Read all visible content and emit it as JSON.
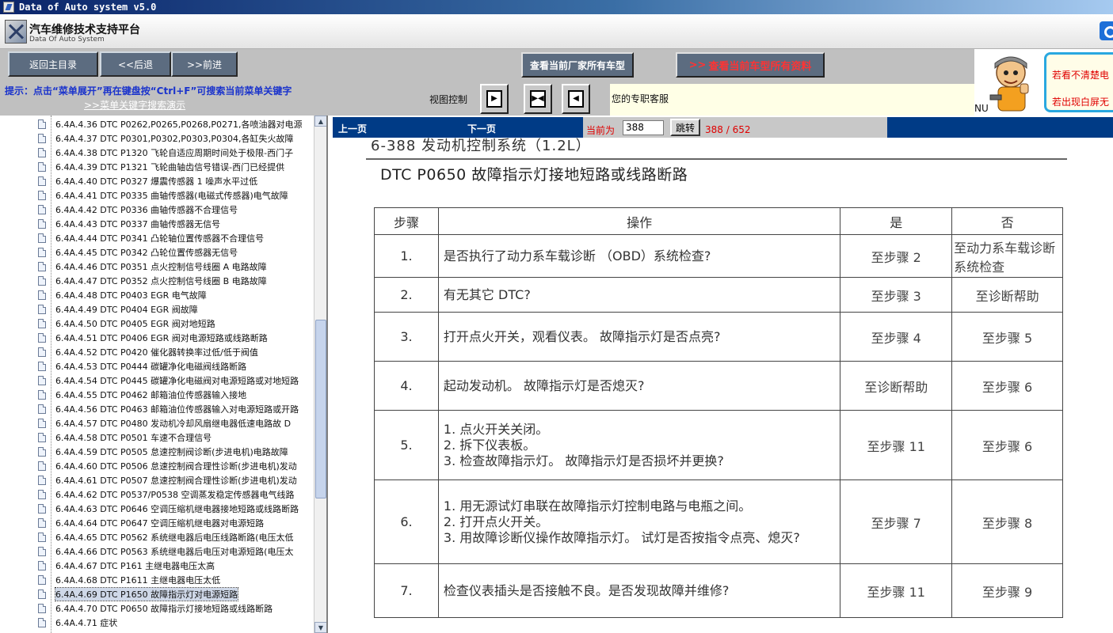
{
  "window": {
    "title": "Data of Auto system v5.0"
  },
  "logo": {
    "title": "汽车维修技术支持平台",
    "subtitle": "Data Of Auto System"
  },
  "toolbar": {
    "home_label": "返回主目录",
    "back_label": "<<后退",
    "forward_label": ">>前进",
    "maker_cars_label": "查看当前厂家所有车型",
    "all_info_label": "查看当前车型所有资料",
    "hint": "提示：点击“菜单展开”再在键盘按“Ctrl+F”可搜索当前菜单关键字",
    "hint_link": ">>菜单关键字搜索演示",
    "view_control_label": "视图控制",
    "service_text": "您的专职客服"
  },
  "ad": {
    "line1": "若看不清楚电",
    "line2": "若出现白屏无",
    "prefix": "NU"
  },
  "tree": {
    "items": [
      "6.4A.4.36 DTC P0262,P0265,P0268,P0271,各喷油器对电源",
      "6.4A.4.37 DTC P0301,P0302,P0303,P0304,各缸失火故障",
      "6.4A.4.38 DTC P1320 飞轮自适应周期时间处于极限-西门子",
      "6.4A.4.39 DTC P1321 飞轮曲轴齿信号错误-西门已经提供",
      "6.4A.4.40 DTC P0327 爆震传感器 1 噪声水平过低",
      "6.4A.4.41 DTC P0335 曲轴传感器(电磁式传感器)电气故障",
      "6.4A.4.42 DTC P0336 曲轴传感器不合理信号",
      "6.4A.4.43 DTC P0337 曲轴传感器无信号",
      "6.4A.4.44 DTC P0341 凸轮轴位置传感器不合理信号",
      "6.4A.4.45 DTC P0342 凸轮位置传感器无信号",
      "6.4A.4.46 DTC P0351 点火控制信号线圈 A 电路故障",
      "6.4A.4.47 DTC P0352 点火控制信号线圈 B 电路故障",
      "6.4A.4.48 DTC P0403 EGR 电气故障",
      "6.4A.4.49 DTC P0404 EGR 阀故障",
      "6.4A.4.50 DTC P0405 EGR 阀对地短路",
      "6.4A.4.51 DTC P0406 EGR 阀对电源短路或线路断路",
      "6.4A.4.52 DTC P0420 催化器转换率过低/低于阀值",
      "6.4A.4.53 DTC P0444 碳罐净化电磁阀线路断路",
      "6.4A.4.54 DTC P0445 碳罐净化电磁阀对电源短路或对地短路",
      "6.4A.4.55 DTC P0462 邮箱油位传感器输入接地",
      "6.4A.4.56 DTC P0463 邮箱油位传感器输入对电源短路或开路",
      "6.4A.4.57 DTC P0480 发动机冷却风扇继电器低速电路故 D",
      "6.4A.4.58 DTC P0501 车速不合理信号",
      "6.4A.4.59 DTC P0505 怠速控制阀诊断(步进电机)电路故障",
      "6.4A.4.60 DTC P0506 怠速控制阀合理性诊断(步进电机)发动",
      "6.4A.4.61 DTC P0507 怠速控制阀合理性诊断(步进电机)发动",
      "6.4A.4.62 DTC P0537/P0538 空调蒸发稳定传感器电气线路",
      "6.4A.4.63 DTC P0646 空调压缩机继电器接地短路或线路断路",
      "6.4A.4.64 DTC P0647 空调压缩机继电器对电源短路",
      "6.4A.4.65 DTC P0562 系统继电器后电压线路断路(电压太低",
      "6.4A.4.66 DTC P0563 系统继电器后电压对电源短路(电压太",
      "6.4A.4.67 DTC P161 主继电器电压太高",
      "6.4A.4.68 DTC P1611 主继电器电压太低",
      "6.4A.4.69 DTC P1650 故障指示灯对电源短路",
      "6.4A.4.70 DTC P0650 故障指示灯接地短路或线路断路",
      "6.4A.4.71 症状"
    ],
    "selected_index": 33
  },
  "docnav": {
    "prev_label": "上一页",
    "next_label": "下一页",
    "current_label": "当前为",
    "page_value": "388",
    "jump_label": "跳转",
    "page_count": "388 / 652"
  },
  "document": {
    "header": "6-388 发动机控制系统（1.2L）",
    "title": "DTC P0650  故障指示灯接地短路或线路断路",
    "columns": [
      "步骤",
      "操作",
      "是",
      "否"
    ],
    "rows": [
      {
        "step": "1.",
        "op": [
          "是否执行了动力系车载诊断 （OBD）系统检查?"
        ],
        "yes": "至步骤 2",
        "no": "至动力系车载诊断系统检查"
      },
      {
        "step": "2.",
        "op": [
          "有无其它 DTC?"
        ],
        "yes": "至步骤 3",
        "no": "至诊断帮助"
      },
      {
        "step": "3.",
        "op": [
          "打开点火开关，观看仪表。 故障指示灯是否点亮?"
        ],
        "yes": "至步骤 4",
        "no": "至步骤 5"
      },
      {
        "step": "4.",
        "op": [
          "起动发动机。 故障指示灯是否熄灭?"
        ],
        "yes": "至诊断帮助",
        "no": "至步骤 6"
      },
      {
        "step": "5.",
        "op": [
          "1. 点火开关关闭。",
          "2. 拆下仪表板。",
          "3. 检查故障指示灯。 故障指示灯是否损坏并更换?"
        ],
        "yes": "至步骤 11",
        "no": "至步骤 6"
      },
      {
        "step": "6.",
        "op": [
          "1. 用无源试灯串联在故障指示灯控制电路与电瓶之间。",
          "2. 打开点火开关。",
          "3. 用故障诊断仪操作故障指示灯。 试灯是否按指令点亮、熄灭?"
        ],
        "yes": "至步骤 7",
        "no": "至步骤 8"
      },
      {
        "step": "7.",
        "op": [
          "检查仪表插头是否接触不良。是否发现故障并维修?"
        ],
        "yes": "至步骤 11",
        "no": "至步骤 9"
      }
    ]
  }
}
